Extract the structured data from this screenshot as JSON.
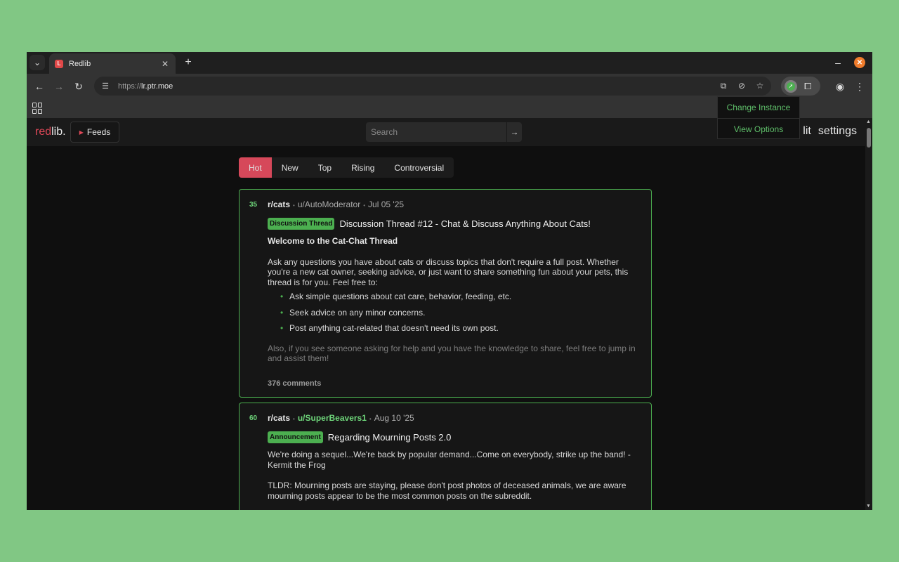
{
  "browser": {
    "tab_title": "Redlib",
    "url_scheme": "https://",
    "url_host": "lr.ptr.moe"
  },
  "extension_popup": {
    "items": [
      "Change Instance",
      "View Options"
    ]
  },
  "site": {
    "logo_red": "red",
    "logo_rest": "lib.",
    "feeds_label": "Feeds",
    "search_placeholder": "Search",
    "nav_right_1": "lit",
    "nav_right_2": "settings"
  },
  "sort_tabs": [
    "Hot",
    "New",
    "Top",
    "Rising",
    "Controversial"
  ],
  "posts": [
    {
      "score": "35",
      "subreddit": "r/cats",
      "author": "u/AutoModerator",
      "date": "Jul 05 '25",
      "flair": "Discussion Thread",
      "title": "Discussion Thread #12 - Chat & Discuss Anything About Cats!",
      "heading": "Welcome to the Cat-Chat Thread",
      "body": "Ask any questions you have about cats or discuss topics that don't require a full post. Whether you're a new cat owner, seeking advice, or just want to share something fun about your pets, this thread is for you. Feel free to:",
      "bullets": [
        "Ask simple questions about cat care, behavior, feeding, etc.",
        "Seek advice on any minor concerns.",
        "Post anything cat-related that doesn't need its own post."
      ],
      "faded": "Also, if you see someone asking for help and you have the knowledge to share, feel free to jump in and assist them!",
      "comments": "376 comments"
    },
    {
      "score": "60",
      "subreddit": "r/cats",
      "author": "u/SuperBeavers1",
      "date": "Aug 10 '25",
      "flair": "Announcement",
      "title": "Regarding Mourning Posts 2.0",
      "body_1": "We're doing a sequel...We're back by popular demand...Come on everybody, strike up the band! -Kermit the Frog",
      "body_2": "TLDR: Mourning posts are staying, please don't post photos of deceased animals, we are aware mourning posts appear to be the most common posts on the subreddit."
    }
  ]
}
